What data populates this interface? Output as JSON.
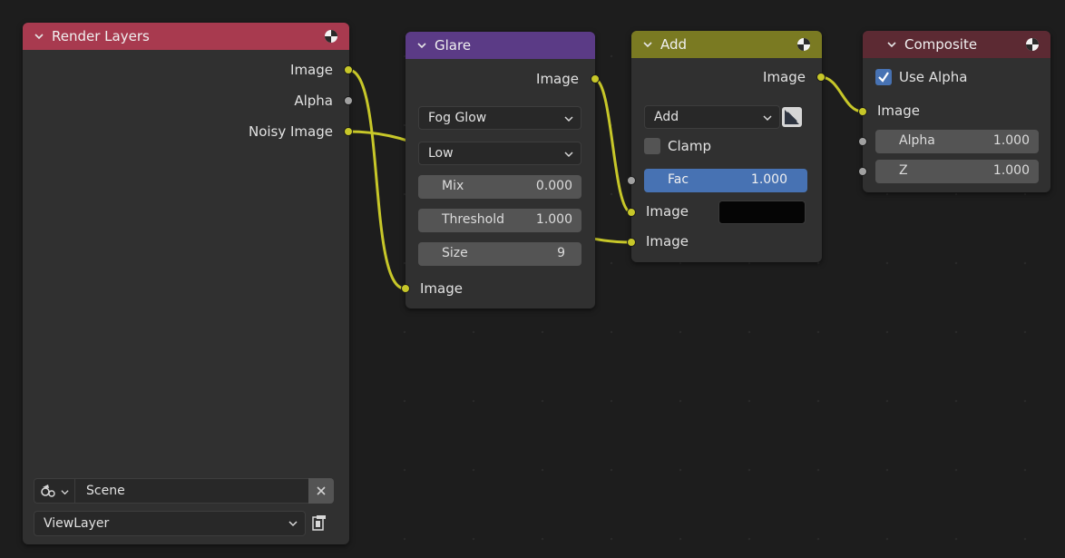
{
  "colors": {
    "canvas": "#1d1d1d",
    "node_body": "#303030",
    "render_layers_header": "#a83a4f",
    "glare_header": "#5b3b86",
    "add_header": "#7a7a22",
    "composite_header": "#5c2a33",
    "socket_color": "#c7c729",
    "socket_float": "#a1a1a1",
    "link_color": "#c7c729",
    "fac_highlight": "#4772b3"
  },
  "render_layers": {
    "title": "Render Layers",
    "outputs": [
      "Image",
      "Alpha",
      "Noisy Image"
    ],
    "scene": {
      "icon": "scene-icon",
      "value": "Scene"
    },
    "view_layer": {
      "value": "ViewLayer",
      "icon": "view-layer-browse-icon"
    }
  },
  "glare": {
    "title": "Glare",
    "output": "Image",
    "glare_type": "Fog Glow",
    "quality": "Low",
    "mix": {
      "label": "Mix",
      "value": "0.000"
    },
    "threshold": {
      "label": "Threshold",
      "value": "1.000"
    },
    "size": {
      "label": "Size",
      "value": "9"
    },
    "input": "Image"
  },
  "add": {
    "title": "Add",
    "output": "Image",
    "blend_type": "Add",
    "clamp": {
      "label": "Clamp",
      "checked": false
    },
    "fac": {
      "label": "Fac",
      "value": "1.000"
    },
    "input1": "Image",
    "input2": "Image"
  },
  "composite": {
    "title": "Composite",
    "use_alpha": {
      "label": "Use Alpha",
      "checked": true
    },
    "input_image": "Image",
    "alpha": {
      "label": "Alpha",
      "value": "1.000"
    },
    "z": {
      "label": "Z",
      "value": "1.000"
    }
  }
}
